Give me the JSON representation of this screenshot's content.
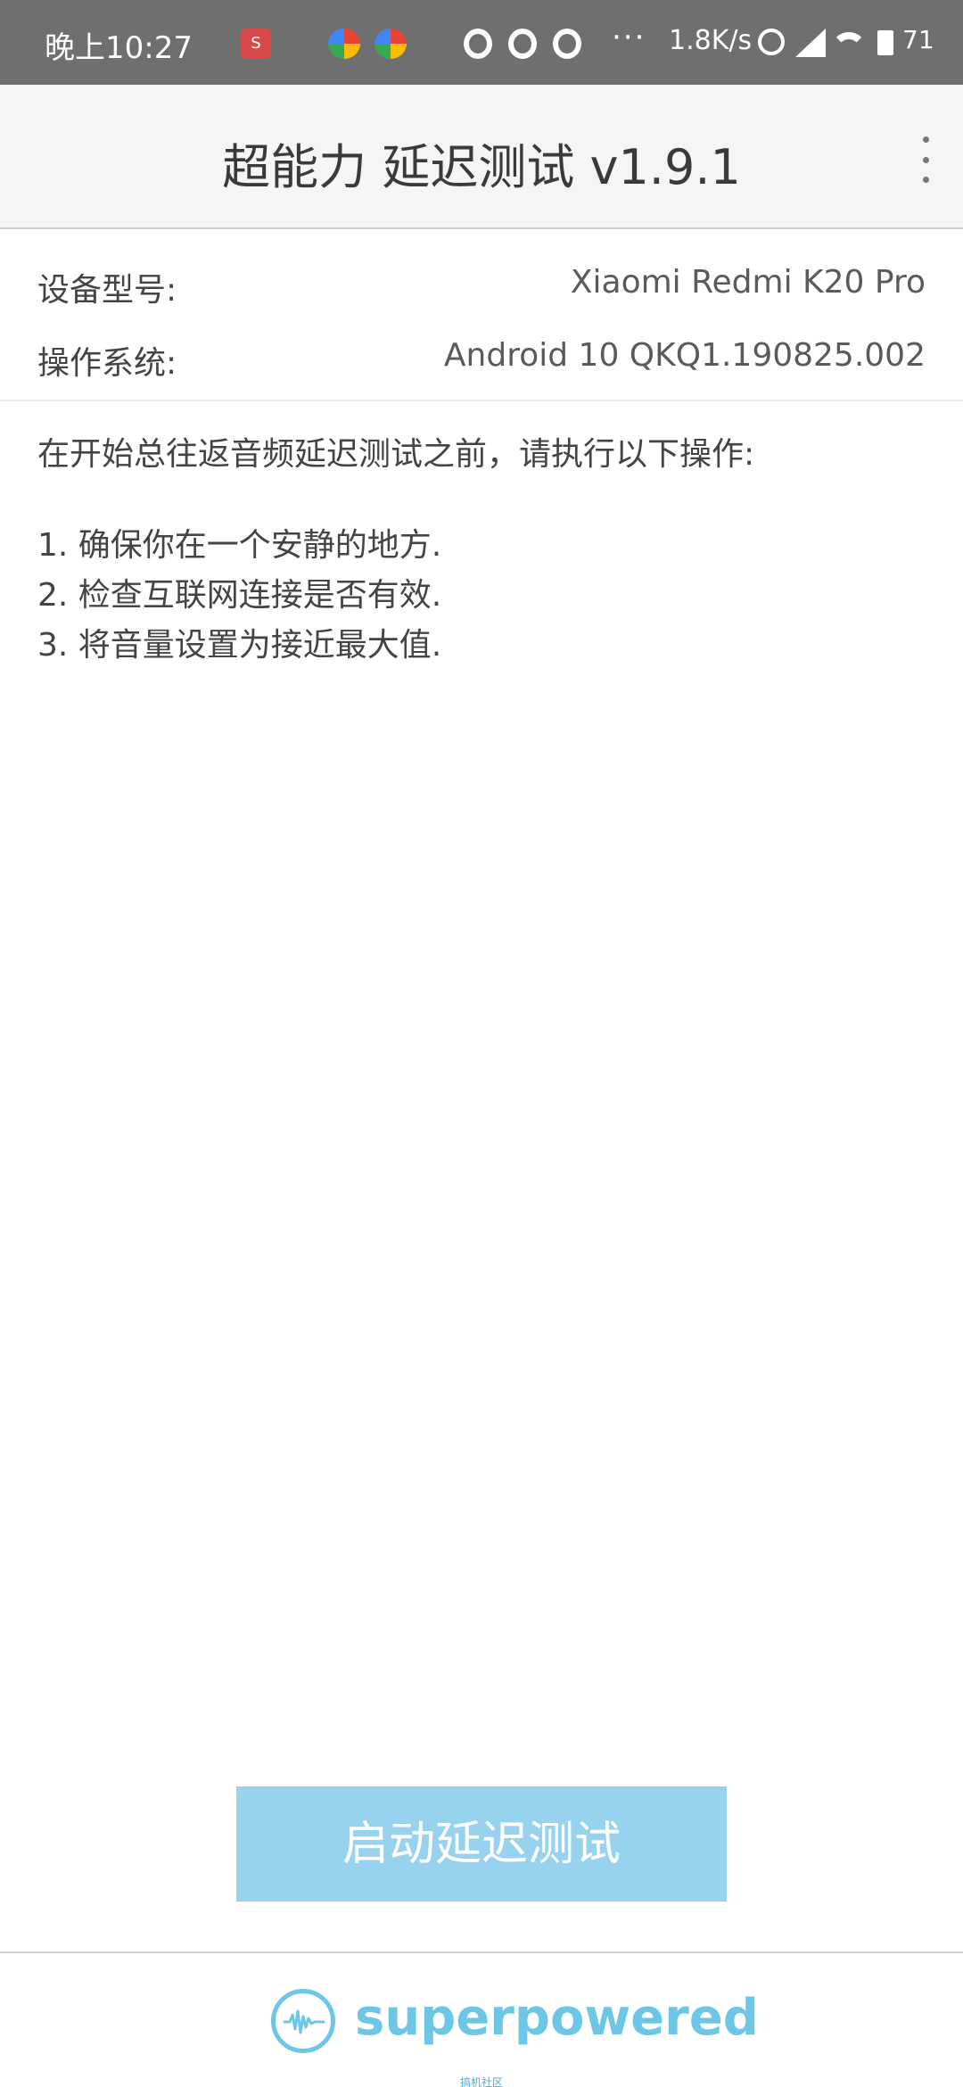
{
  "status_bar": {
    "time": "晚上10:27",
    "network_speed": "1.8K/s",
    "battery_level": "71",
    "more_indicator": "···",
    "icons": [
      "app-badge-icon",
      "pinwheel-icon",
      "pinwheel-icon",
      "qq-icon",
      "qq-icon",
      "qq-icon",
      "alarm-icon",
      "signal-icon",
      "wifi-icon",
      "battery-icon"
    ]
  },
  "app_bar": {
    "title": "超能力 延迟测试 v1.9.1",
    "menu_icon": "more-vertical-icon"
  },
  "device_info": {
    "model_label": "设备型号:",
    "model_value": "Xiaomi Redmi K20 Pro",
    "os_label": "操作系统:",
    "os_value": "Android 10 QKQ1.190825.002"
  },
  "instructions": {
    "intro": "在开始总往返音频延迟测试之前，请执行以下操作:",
    "steps": [
      "1. 确保你在一个安静的地方.",
      "2. 检查互联网连接是否有效.",
      "3. 将音量设置为接近最大值."
    ]
  },
  "start_button": {
    "label": "启动延迟测试"
  },
  "footer": {
    "brand": "superpowered",
    "watermark": "搞机社区"
  },
  "colors": {
    "status_bar_bg": "#6f6f6f",
    "app_bar_bg": "#f5f5f5",
    "button_bg": "#97d3ee",
    "brand": "#6ec6e6"
  }
}
